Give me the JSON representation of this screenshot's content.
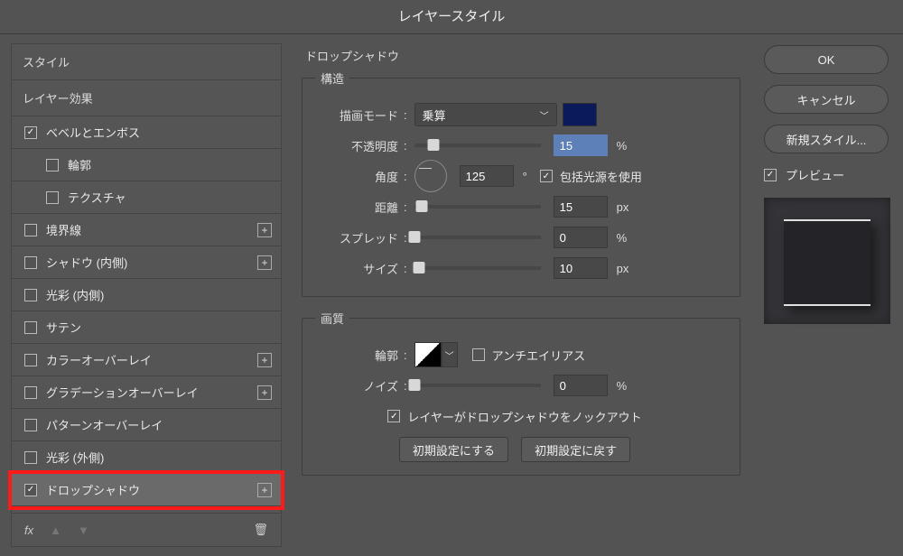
{
  "title": "レイヤースタイル",
  "sidebar": {
    "styles_header": "スタイル",
    "effects_header": "レイヤー効果",
    "items": [
      {
        "label": "ベベルとエンボス",
        "checked": true,
        "plus": false,
        "sub": false
      },
      {
        "label": "輪郭",
        "checked": false,
        "plus": false,
        "sub": true
      },
      {
        "label": "テクスチャ",
        "checked": false,
        "plus": false,
        "sub": true
      },
      {
        "label": "境界線",
        "checked": false,
        "plus": true,
        "sub": false
      },
      {
        "label": "シャドウ (内側)",
        "checked": false,
        "plus": true,
        "sub": false
      },
      {
        "label": "光彩 (内側)",
        "checked": false,
        "plus": false,
        "sub": false
      },
      {
        "label": "サテン",
        "checked": false,
        "plus": false,
        "sub": false
      },
      {
        "label": "カラーオーバーレイ",
        "checked": false,
        "plus": true,
        "sub": false
      },
      {
        "label": "グラデーションオーバーレイ",
        "checked": false,
        "plus": true,
        "sub": false
      },
      {
        "label": "パターンオーバーレイ",
        "checked": false,
        "plus": false,
        "sub": false
      },
      {
        "label": "光彩 (外側)",
        "checked": false,
        "plus": false,
        "sub": false
      },
      {
        "label": "ドロップシャドウ",
        "checked": true,
        "plus": true,
        "sub": false,
        "selected": true,
        "highlight": true
      }
    ],
    "fx_label": "fx"
  },
  "panel": {
    "title": "ドロップシャドウ",
    "structure_legend": "構造",
    "blend_mode_label": "描画モード",
    "blend_mode_value": "乗算",
    "opacity_label": "不透明度",
    "opacity_value": "15",
    "opacity_unit": "%",
    "angle_label": "角度",
    "angle_value": "125",
    "angle_unit": "°",
    "global_light_label": "包括光源を使用",
    "distance_label": "距離",
    "distance_value": "15",
    "distance_unit": "px",
    "spread_label": "スプレッド",
    "spread_value": "0",
    "spread_unit": "%",
    "size_label": "サイズ",
    "size_value": "10",
    "size_unit": "px",
    "quality_legend": "画質",
    "contour_label": "輪郭",
    "antialias_label": "アンチエイリアス",
    "noise_label": "ノイズ",
    "noise_value": "0",
    "noise_unit": "%",
    "knockout_label": "レイヤーがドロップシャドウをノックアウト",
    "reset_btn": "初期設定にする",
    "default_btn": "初期設定に戻す"
  },
  "right": {
    "ok": "OK",
    "cancel": "キャンセル",
    "new_style": "新規スタイル...",
    "preview_label": "プレビュー"
  }
}
